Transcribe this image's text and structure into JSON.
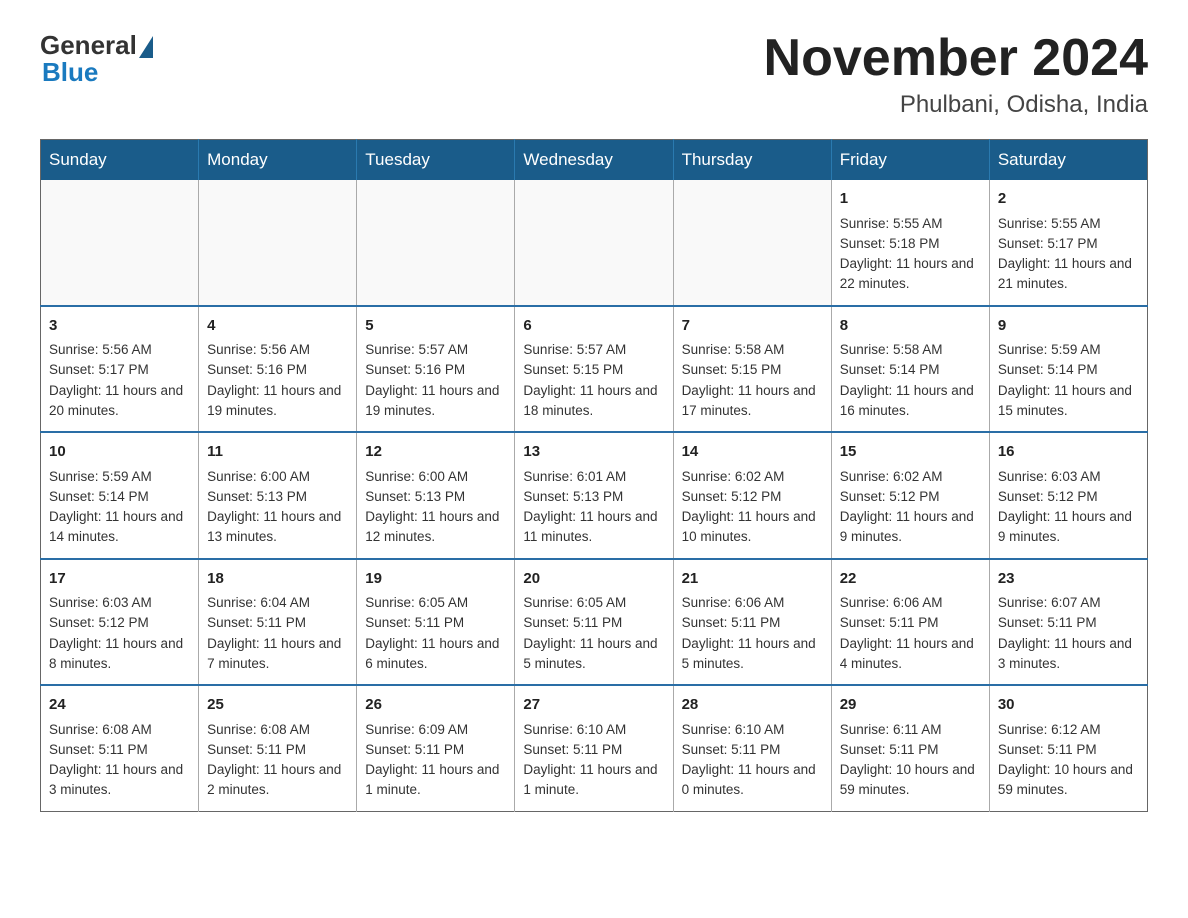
{
  "logo": {
    "general": "General",
    "blue": "Blue"
  },
  "header": {
    "month": "November 2024",
    "location": "Phulbani, Odisha, India"
  },
  "days_of_week": [
    "Sunday",
    "Monday",
    "Tuesday",
    "Wednesday",
    "Thursday",
    "Friday",
    "Saturday"
  ],
  "weeks": [
    [
      {
        "day": "",
        "info": ""
      },
      {
        "day": "",
        "info": ""
      },
      {
        "day": "",
        "info": ""
      },
      {
        "day": "",
        "info": ""
      },
      {
        "day": "",
        "info": ""
      },
      {
        "day": "1",
        "info": "Sunrise: 5:55 AM\nSunset: 5:18 PM\nDaylight: 11 hours and 22 minutes."
      },
      {
        "day": "2",
        "info": "Sunrise: 5:55 AM\nSunset: 5:17 PM\nDaylight: 11 hours and 21 minutes."
      }
    ],
    [
      {
        "day": "3",
        "info": "Sunrise: 5:56 AM\nSunset: 5:17 PM\nDaylight: 11 hours and 20 minutes."
      },
      {
        "day": "4",
        "info": "Sunrise: 5:56 AM\nSunset: 5:16 PM\nDaylight: 11 hours and 19 minutes."
      },
      {
        "day": "5",
        "info": "Sunrise: 5:57 AM\nSunset: 5:16 PM\nDaylight: 11 hours and 19 minutes."
      },
      {
        "day": "6",
        "info": "Sunrise: 5:57 AM\nSunset: 5:15 PM\nDaylight: 11 hours and 18 minutes."
      },
      {
        "day": "7",
        "info": "Sunrise: 5:58 AM\nSunset: 5:15 PM\nDaylight: 11 hours and 17 minutes."
      },
      {
        "day": "8",
        "info": "Sunrise: 5:58 AM\nSunset: 5:14 PM\nDaylight: 11 hours and 16 minutes."
      },
      {
        "day": "9",
        "info": "Sunrise: 5:59 AM\nSunset: 5:14 PM\nDaylight: 11 hours and 15 minutes."
      }
    ],
    [
      {
        "day": "10",
        "info": "Sunrise: 5:59 AM\nSunset: 5:14 PM\nDaylight: 11 hours and 14 minutes."
      },
      {
        "day": "11",
        "info": "Sunrise: 6:00 AM\nSunset: 5:13 PM\nDaylight: 11 hours and 13 minutes."
      },
      {
        "day": "12",
        "info": "Sunrise: 6:00 AM\nSunset: 5:13 PM\nDaylight: 11 hours and 12 minutes."
      },
      {
        "day": "13",
        "info": "Sunrise: 6:01 AM\nSunset: 5:13 PM\nDaylight: 11 hours and 11 minutes."
      },
      {
        "day": "14",
        "info": "Sunrise: 6:02 AM\nSunset: 5:12 PM\nDaylight: 11 hours and 10 minutes."
      },
      {
        "day": "15",
        "info": "Sunrise: 6:02 AM\nSunset: 5:12 PM\nDaylight: 11 hours and 9 minutes."
      },
      {
        "day": "16",
        "info": "Sunrise: 6:03 AM\nSunset: 5:12 PM\nDaylight: 11 hours and 9 minutes."
      }
    ],
    [
      {
        "day": "17",
        "info": "Sunrise: 6:03 AM\nSunset: 5:12 PM\nDaylight: 11 hours and 8 minutes."
      },
      {
        "day": "18",
        "info": "Sunrise: 6:04 AM\nSunset: 5:11 PM\nDaylight: 11 hours and 7 minutes."
      },
      {
        "day": "19",
        "info": "Sunrise: 6:05 AM\nSunset: 5:11 PM\nDaylight: 11 hours and 6 minutes."
      },
      {
        "day": "20",
        "info": "Sunrise: 6:05 AM\nSunset: 5:11 PM\nDaylight: 11 hours and 5 minutes."
      },
      {
        "day": "21",
        "info": "Sunrise: 6:06 AM\nSunset: 5:11 PM\nDaylight: 11 hours and 5 minutes."
      },
      {
        "day": "22",
        "info": "Sunrise: 6:06 AM\nSunset: 5:11 PM\nDaylight: 11 hours and 4 minutes."
      },
      {
        "day": "23",
        "info": "Sunrise: 6:07 AM\nSunset: 5:11 PM\nDaylight: 11 hours and 3 minutes."
      }
    ],
    [
      {
        "day": "24",
        "info": "Sunrise: 6:08 AM\nSunset: 5:11 PM\nDaylight: 11 hours and 3 minutes."
      },
      {
        "day": "25",
        "info": "Sunrise: 6:08 AM\nSunset: 5:11 PM\nDaylight: 11 hours and 2 minutes."
      },
      {
        "day": "26",
        "info": "Sunrise: 6:09 AM\nSunset: 5:11 PM\nDaylight: 11 hours and 1 minute."
      },
      {
        "day": "27",
        "info": "Sunrise: 6:10 AM\nSunset: 5:11 PM\nDaylight: 11 hours and 1 minute."
      },
      {
        "day": "28",
        "info": "Sunrise: 6:10 AM\nSunset: 5:11 PM\nDaylight: 11 hours and 0 minutes."
      },
      {
        "day": "29",
        "info": "Sunrise: 6:11 AM\nSunset: 5:11 PM\nDaylight: 10 hours and 59 minutes."
      },
      {
        "day": "30",
        "info": "Sunrise: 6:12 AM\nSunset: 5:11 PM\nDaylight: 10 hours and 59 minutes."
      }
    ]
  ]
}
